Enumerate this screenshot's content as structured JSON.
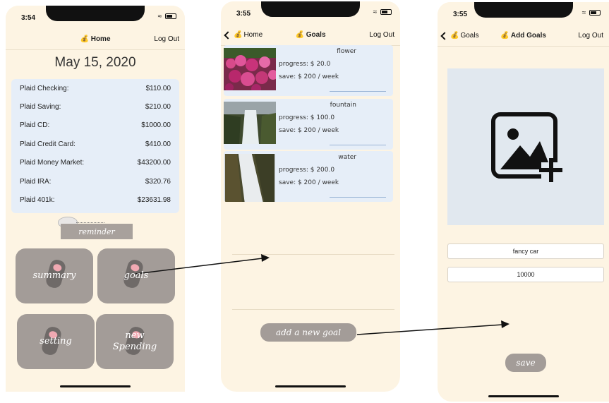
{
  "screen_home": {
    "time": "3:54",
    "nav": {
      "title": "Home",
      "logout": "Log Out"
    },
    "date": "May 15, 2020",
    "accounts": [
      {
        "name": "Plaid Checking:",
        "amount": "$110.00"
      },
      {
        "name": "Plaid Saving:",
        "amount": "$210.00"
      },
      {
        "name": "Plaid CD:",
        "amount": "$1000.00"
      },
      {
        "name": "Plaid Credit Card:",
        "amount": "$410.00"
      },
      {
        "name": "Plaid Money Market:",
        "amount": "$43200.00"
      },
      {
        "name": "Plaid IRA:",
        "amount": "$320.76"
      },
      {
        "name": "Plaid 401k:",
        "amount": "$23631.98"
      }
    ],
    "reminder": "reminder",
    "tiles": {
      "summary": "summary",
      "goals": "goals",
      "setting": "setting",
      "new_spending_1": "new",
      "new_spending_2": "Spending"
    }
  },
  "screen_goals": {
    "time": "3:55",
    "nav": {
      "back": "Home",
      "title": "Goals",
      "logout": "Log Out"
    },
    "goals": [
      {
        "name": "flower",
        "progress": "progress: $ 20.0",
        "save": "save: $ 200 / week"
      },
      {
        "name": "fountain",
        "progress": "progress: $ 100.0",
        "save": "save: $ 200 / week"
      },
      {
        "name": "water",
        "progress": "progress: $ 200.0",
        "save": "save: $ 200 / week"
      }
    ],
    "add_goal": "add a new goal"
  },
  "screen_add_goal": {
    "time": "3:55",
    "nav": {
      "back": "Goals",
      "title": "Add Goals",
      "logout": "Log Out"
    },
    "name_value": "fancy car",
    "amount_value": "10000",
    "save": "save"
  },
  "colors": {
    "background": "#fdf4e3",
    "card": "#e6eef8",
    "button": "#a39c98"
  }
}
